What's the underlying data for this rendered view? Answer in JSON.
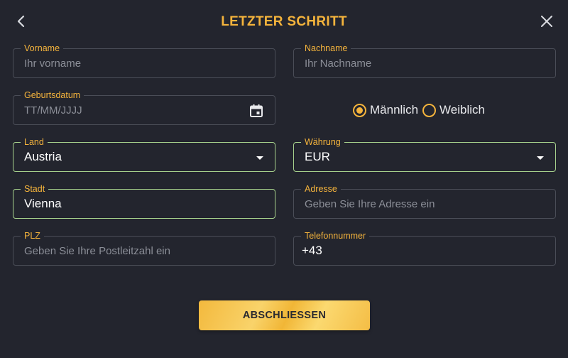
{
  "header": {
    "title": "LETZTER SCHRITT"
  },
  "form": {
    "first_name": {
      "label": "Vorname",
      "placeholder": "Ihr vorname"
    },
    "last_name": {
      "label": "Nachname",
      "placeholder": "Ihr Nachname"
    },
    "birthdate": {
      "label": "Geburtsdatum",
      "placeholder": "TT/MM/JJJJ"
    },
    "gender": {
      "options": [
        {
          "label": "Männlich",
          "selected": true
        },
        {
          "label": "Weiblich",
          "selected": false
        }
      ]
    },
    "country": {
      "label": "Land",
      "value": "Austria"
    },
    "currency": {
      "label": "Währung",
      "value": "EUR"
    },
    "city": {
      "label": "Stadt",
      "value": "Vienna"
    },
    "address": {
      "label": "Adresse",
      "placeholder": "Geben Sie Ihre Adresse ein"
    },
    "zip": {
      "label": "PLZ",
      "placeholder": "Geben Sie Ihre Postleitzahl ein"
    },
    "phone": {
      "label": "Telefonnummer",
      "value": "+43"
    }
  },
  "submit": {
    "label": "ABSCHLIESSEN"
  },
  "colors": {
    "background": "#23252e",
    "accent": "#f5b43c",
    "valid_border": "#a6d08c",
    "field_border": "#4a4d57"
  },
  "icons": {
    "back": "chevron-left-icon",
    "close": "close-icon",
    "calendar": "calendar-icon",
    "dropdown": "caret-down-icon"
  }
}
